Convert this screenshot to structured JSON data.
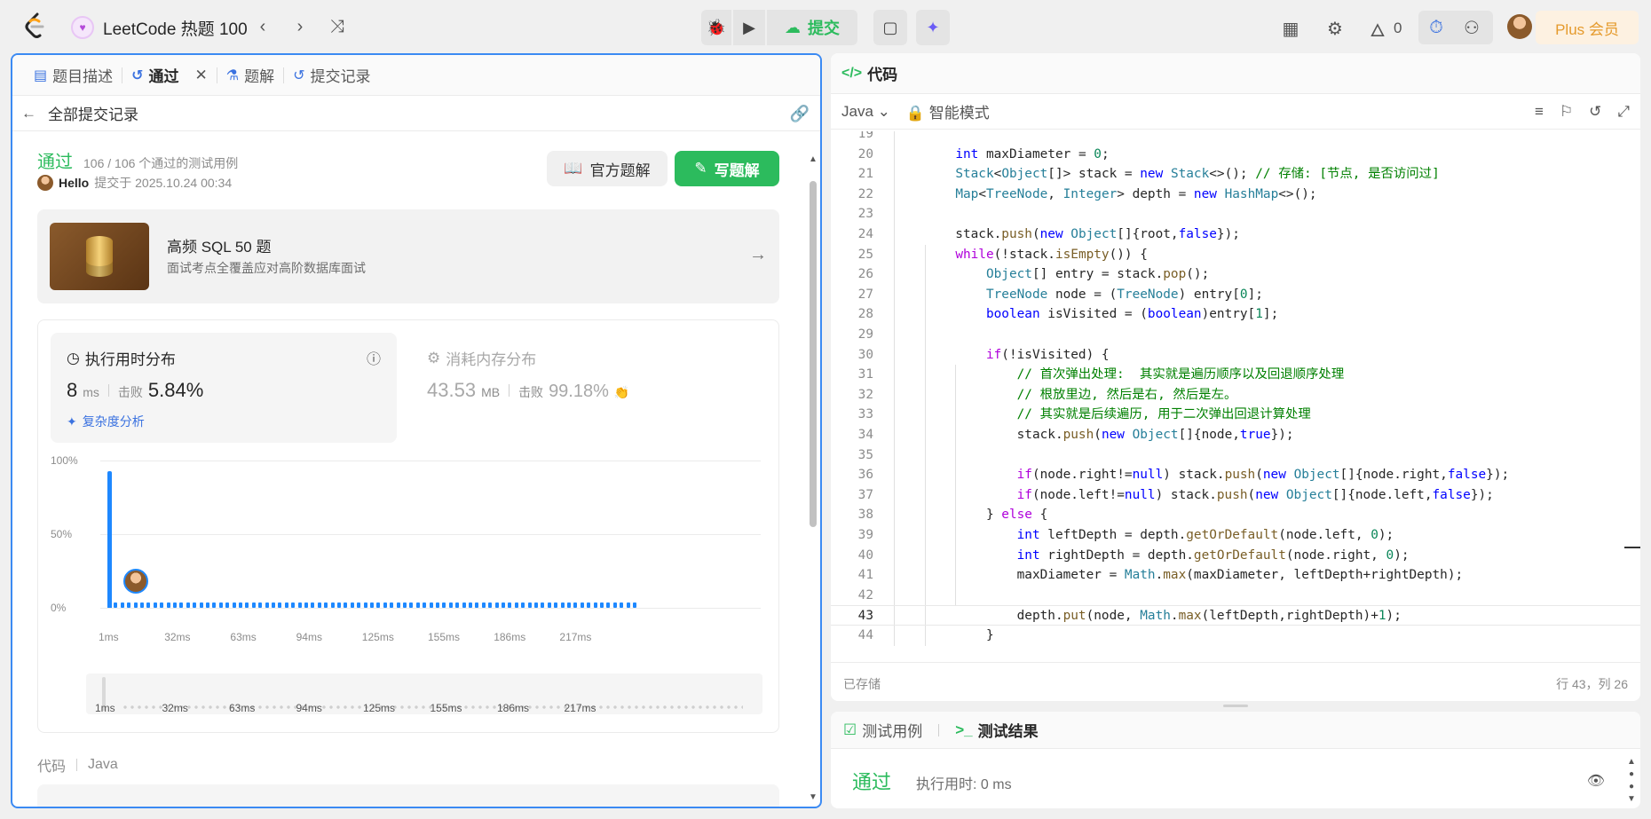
{
  "topbar": {
    "problem_list_title": "LeetCode 热题 100",
    "submit_label": "提交",
    "streak_count": "0",
    "plus_label": "Plus 会员"
  },
  "left": {
    "tabs": [
      {
        "label": "题目描述"
      },
      {
        "label": "通过"
      },
      {
        "label": "题解"
      },
      {
        "label": "提交记录"
      }
    ],
    "back_label": "全部提交记录",
    "status": "通过",
    "testcases": "106 / 106 个通过的测试用例",
    "username": "Hello",
    "submitted_at": "提交于 2025.10.24 00:34",
    "official_solution_label": "官方题解",
    "write_solution_label": "写题解",
    "promo": {
      "title": "高频 SQL 50 题",
      "subtitle": "面试考点全覆盖应对高阶数据库面试"
    },
    "runtime": {
      "title": "执行用时分布",
      "value": "8",
      "unit": "ms",
      "beats_label": "击败",
      "beats": "5.84%",
      "complexity_label": "复杂度分析"
    },
    "memory": {
      "title": "消耗内存分布",
      "value": "43.53",
      "unit": "MB",
      "beats_label": "击败",
      "beats": "99.18%"
    },
    "code_label": "代码",
    "code_lang": "Java"
  },
  "chart_data": {
    "type": "bar",
    "y_ticks": [
      "100%",
      "50%",
      "0%"
    ],
    "ylim": [
      0,
      100
    ],
    "x_ticks": [
      "1ms",
      "32ms",
      "63ms",
      "94ms",
      "125ms",
      "155ms",
      "186ms",
      "217ms"
    ],
    "first_bar_value": 93,
    "tail_bar_count": 80,
    "tail_bar_value": 0.5,
    "brush_ticks": [
      "1ms",
      "32ms",
      "63ms",
      "94ms",
      "125ms",
      "155ms",
      "186ms",
      "217ms"
    ],
    "bar_color": "#1e88ff"
  },
  "code_panel": {
    "tab_label": "代码",
    "language": "Java",
    "mode": "智能模式",
    "status_saved": "已存储",
    "cursor_pos": "行 43，列 26",
    "lines": [
      {
        "n": "19",
        "t": ""
      },
      {
        "n": "20",
        "t": "        int maxDiameter = 0;"
      },
      {
        "n": "21",
        "t": "        Stack<Object[]> stack = new Stack<>(); // 存储: [节点, 是否访问过]"
      },
      {
        "n": "22",
        "t": "        Map<TreeNode, Integer> depth = new HashMap<>();"
      },
      {
        "n": "23",
        "t": ""
      },
      {
        "n": "24",
        "t": "        stack.push(new Object[]{root,false});"
      },
      {
        "n": "25",
        "t": "        while(!stack.isEmpty()) {"
      },
      {
        "n": "26",
        "t": "            Object[] entry = stack.pop();"
      },
      {
        "n": "27",
        "t": "            TreeNode node = (TreeNode) entry[0];"
      },
      {
        "n": "28",
        "t": "            boolean isVisited = (boolean)entry[1];"
      },
      {
        "n": "29",
        "t": ""
      },
      {
        "n": "30",
        "t": "            if(!isVisited) {"
      },
      {
        "n": "31",
        "t": "                // 首次弹出处理:  其实就是遍历顺序以及回退顺序处理"
      },
      {
        "n": "32",
        "t": "                // 根放里边, 然后是右, 然后是左。"
      },
      {
        "n": "33",
        "t": "                // 其实就是后续遍历, 用于二次弹出回退计算处理"
      },
      {
        "n": "34",
        "t": "                stack.push(new Object[]{node,true});"
      },
      {
        "n": "35",
        "t": ""
      },
      {
        "n": "36",
        "t": "                if(node.right!=null) stack.push(new Object[]{node.right,false});"
      },
      {
        "n": "37",
        "t": "                if(node.left!=null) stack.push(new Object[]{node.left,false});"
      },
      {
        "n": "38",
        "t": "            } else {"
      },
      {
        "n": "39",
        "t": "                int leftDepth = depth.getOrDefault(node.left, 0);"
      },
      {
        "n": "40",
        "t": "                int rightDepth = depth.getOrDefault(node.right, 0);"
      },
      {
        "n": "41",
        "t": "                maxDiameter = Math.max(maxDiameter, leftDepth+rightDepth);"
      },
      {
        "n": "42",
        "t": ""
      },
      {
        "n": "43",
        "t": "                depth.put(node, Math.max(leftDepth,rightDepth)+1);"
      },
      {
        "n": "44",
        "t": "            }"
      }
    ],
    "current_line": "43"
  },
  "result_panel": {
    "tab_testcase": "测试用例",
    "tab_result": "测试结果",
    "status": "通过",
    "runtime": "执行用时: 0 ms"
  }
}
